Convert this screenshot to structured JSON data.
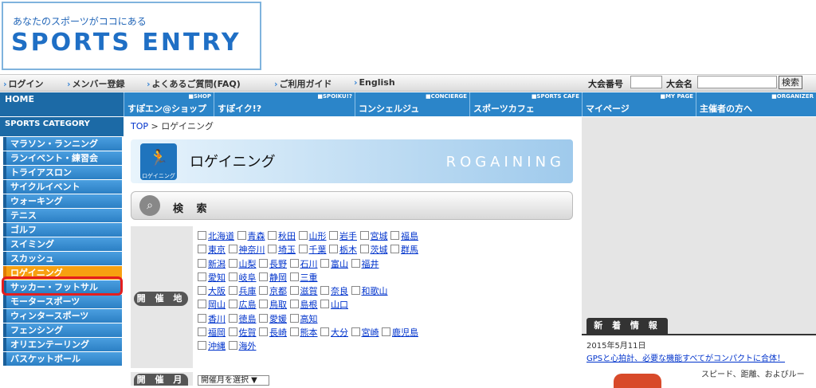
{
  "logo": {
    "tagline": "あなたのスポーツがココにある",
    "brand": "SPORTS ENTRY"
  },
  "topnav": {
    "items": [
      "ログイン",
      "メンバー登録",
      "よくあるご質問(FAQ)",
      "ご利用ガイド",
      "English"
    ],
    "event_no_label": "大会番号",
    "event_name_label": "大会名",
    "search_button": "検索"
  },
  "mainnav": {
    "home": "HOME",
    "tabs": [
      {
        "en": "■SHOP",
        "jp": "すぽエン@ショップ"
      },
      {
        "en": "■SPOIKU!?",
        "jp": "すぽイク!?"
      },
      {
        "en": "■CONCIERGE",
        "jp": "コンシェルジュ"
      },
      {
        "en": "■SPORTS CAFE",
        "jp": "スポーツカフェ"
      },
      {
        "en": "■MY PAGE",
        "jp": "マイページ"
      },
      {
        "en": "■ORGANIZER",
        "jp": "主催者の方へ"
      }
    ]
  },
  "sidebar": {
    "heading": "SPORTS CATEGORY",
    "items": [
      "マラソン・ランニング",
      "ランイベント・練習会",
      "トライアスロン",
      "サイクルイベント",
      "ウォーキング",
      "テニス",
      "ゴルフ",
      "スイミング",
      "スカッシュ",
      "ロゲイニング",
      "サッカー・フットサル",
      "モータースポーツ",
      "ウィンタースポーツ",
      "フェンシング",
      "オリエンテーリング",
      "バスケットボール"
    ],
    "active_index": 9
  },
  "breadcrumb": {
    "top": "TOP",
    "sep": " > ",
    "current": "ロゲイニング"
  },
  "banner": {
    "title": "ロゲイニング",
    "en": "ROGAINING",
    "icon_caption": "ロゲイニング"
  },
  "search": {
    "label": "検 索"
  },
  "venue": {
    "label": "開 催 地",
    "lines": [
      [
        "北海道",
        "青森",
        "秋田",
        "山形",
        "岩手",
        "宮城",
        "福島"
      ],
      [
        "東京",
        "神奈川",
        "埼玉",
        "千葉",
        "栃木",
        "茨城",
        "群馬"
      ],
      [
        "新潟",
        "山梨",
        "長野",
        "石川",
        "富山",
        "福井"
      ],
      [
        "愛知",
        "岐阜",
        "静岡",
        "三重"
      ],
      [
        "大阪",
        "兵庫",
        "京都",
        "滋賀",
        "奈良",
        "和歌山"
      ],
      [
        "岡山",
        "広島",
        "鳥取",
        "島根",
        "山口"
      ],
      [
        "香川",
        "徳島",
        "愛媛",
        "高知"
      ],
      [
        "福岡",
        "佐賀",
        "長崎",
        "熊本",
        "大分",
        "宮崎",
        "鹿児島"
      ],
      [
        "沖縄",
        "海外"
      ]
    ]
  },
  "month": {
    "label": "開 催 月",
    "select_value": "開催月を選択 ▼"
  },
  "news": {
    "heading": "新 着 情 報",
    "date": "2015年5月11日",
    "link": "GPSと心拍計、必要な機能すべてがコンパクトに合体！",
    "desc": "スピード、距離、およびルー"
  }
}
